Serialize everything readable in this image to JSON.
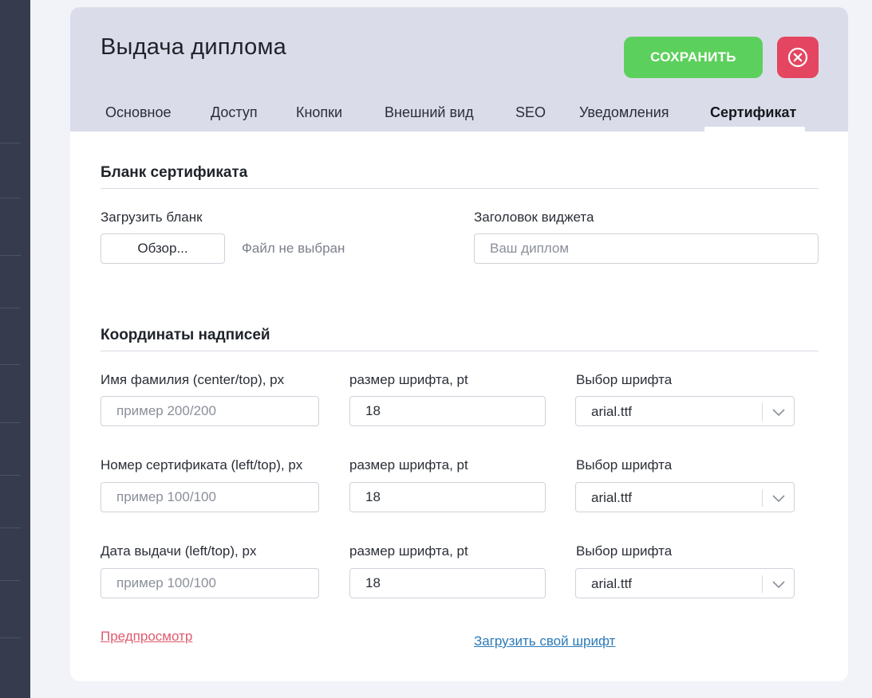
{
  "header": {
    "title": "Выдача диплома",
    "save_label": "СОХРАНИТЬ"
  },
  "tabs": [
    {
      "label": "Основное"
    },
    {
      "label": "Доступ"
    },
    {
      "label": "Кнопки"
    },
    {
      "label": "Внешний вид"
    },
    {
      "label": "SEO"
    },
    {
      "label": "Уведомления"
    },
    {
      "label": "Сертификат",
      "active": true
    }
  ],
  "blank": {
    "title": "Бланк сертификата",
    "upload_label": "Загрузить бланк",
    "browse_label": "Обзор...",
    "file_status": "Файл не выбран",
    "widget_title_label": "Заголовок виджета",
    "widget_title_placeholder": "Ваш диплом"
  },
  "coords": {
    "title": "Координаты надписей",
    "rows": [
      {
        "label": "Имя фамилия (center/top), px",
        "placeholder": "пример 200/200",
        "size_label": "размер шрифта, pt",
        "size_value": "18",
        "font_label": "Выбор шрифта",
        "font_value": "arial.ttf"
      },
      {
        "label": "Номер сертификата (left/top), px",
        "placeholder": "пример 100/100",
        "size_label": "размер шрифта, pt",
        "size_value": "18",
        "font_label": "Выбор шрифта",
        "font_value": "arial.ttf"
      },
      {
        "label": "Дата выдачи (left/top), px",
        "placeholder": "пример 100/100",
        "size_label": "размер шрифта, pt",
        "size_value": "18",
        "font_label": "Выбор шрифта",
        "font_value": "arial.ttf"
      }
    ]
  },
  "links": {
    "preview": "Предпросмотр",
    "upload_font": "Загрузить свой шрифт"
  },
  "icons": {
    "close": "close-circle-icon",
    "select_arrow": "chevron-down-icon"
  },
  "colors": {
    "save": "#5cd05c",
    "close": "#e44560",
    "header_bg": "#dbdcea",
    "preview_link": "#e05a6f",
    "font_link": "#2c7ab8"
  }
}
